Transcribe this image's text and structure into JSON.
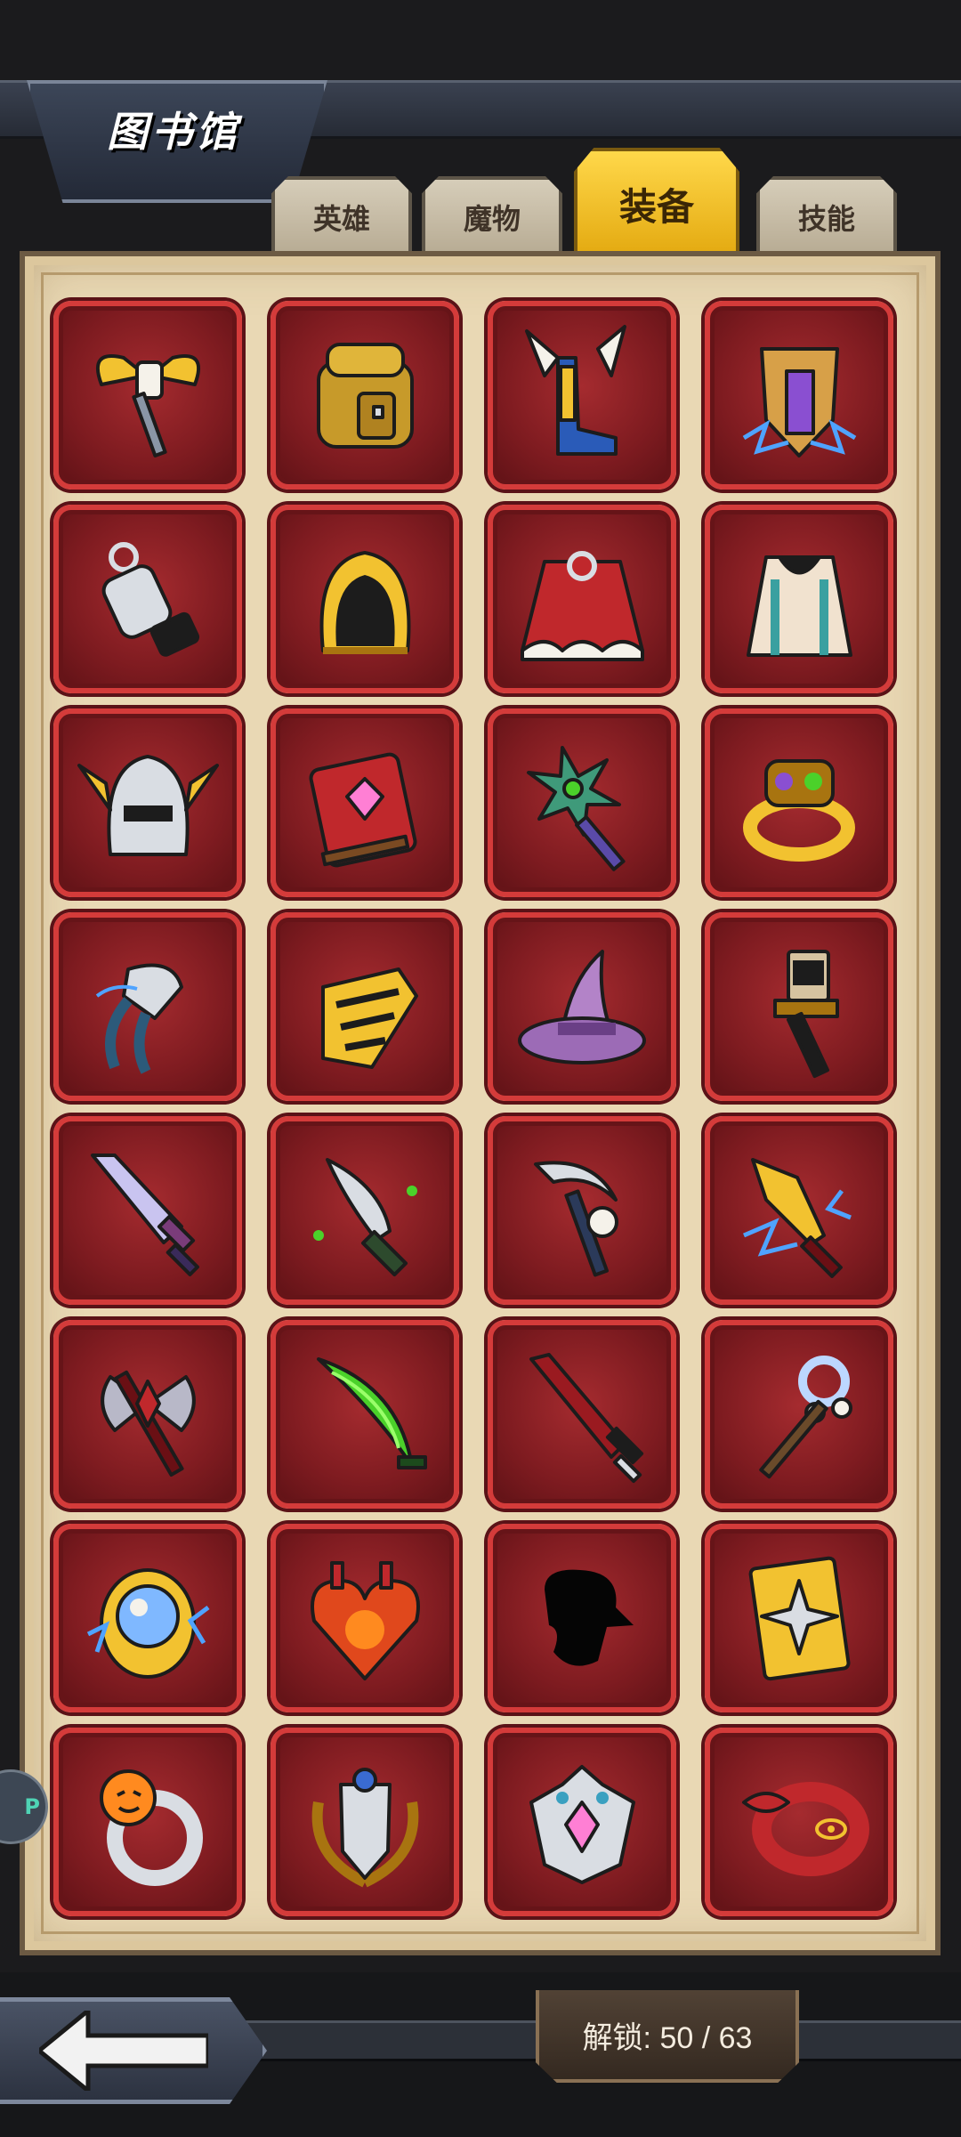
{
  "header": {
    "title": "图书馆"
  },
  "tabs": [
    {
      "label": "英雄",
      "active": false
    },
    {
      "label": "魔物",
      "active": false
    },
    {
      "label": "装备",
      "active": true
    },
    {
      "label": "技能",
      "active": false
    }
  ],
  "items": [
    {
      "icon": "winged-golden-hammer-icon",
      "locked": false
    },
    {
      "icon": "leather-backpack-icon",
      "locked": false
    },
    {
      "icon": "winged-boots-icon",
      "locked": false
    },
    {
      "icon": "lightning-shield-icon",
      "locked": false
    },
    {
      "icon": "silver-whistle-icon",
      "locked": false
    },
    {
      "icon": "golden-hood-icon",
      "locked": false
    },
    {
      "icon": "fur-cloak-icon",
      "locked": false
    },
    {
      "icon": "ornate-cape-icon",
      "locked": false
    },
    {
      "icon": "winged-helmet-icon",
      "locked": false
    },
    {
      "icon": "gem-spellbook-icon",
      "locked": false
    },
    {
      "icon": "shuriken-staff-icon",
      "locked": false
    },
    {
      "icon": "jeweled-ring-icon",
      "locked": false
    },
    {
      "icon": "frost-claw-gauntlet-icon",
      "locked": false
    },
    {
      "icon": "golden-gauntlet-icon",
      "locked": false
    },
    {
      "icon": "wizard-hat-icon",
      "locked": false
    },
    {
      "icon": "war-hammer-icon",
      "locked": false
    },
    {
      "icon": "crystal-sword-icon",
      "locked": false
    },
    {
      "icon": "poison-dagger-icon",
      "locked": false
    },
    {
      "icon": "skull-scythe-icon",
      "locked": false
    },
    {
      "icon": "lightning-dagger-icon",
      "locked": false
    },
    {
      "icon": "battle-axe-icon",
      "locked": false
    },
    {
      "icon": "green-blade-icon",
      "locked": false
    },
    {
      "icon": "crimson-greatsword-icon",
      "locked": false
    },
    {
      "icon": "bell-scepter-icon",
      "locked": false
    },
    {
      "icon": "lightning-orb-icon",
      "locked": false
    },
    {
      "icon": "burning-heart-icon",
      "locked": false
    },
    {
      "icon": "locked-silhouette-icon",
      "locked": true
    },
    {
      "icon": "spiked-shield-icon",
      "locked": false
    },
    {
      "icon": "pumpkin-ring-icon",
      "locked": false
    },
    {
      "icon": "laurel-shield-icon",
      "locked": false
    },
    {
      "icon": "gem-crown-icon",
      "locked": false
    },
    {
      "icon": "eye-bracelet-icon",
      "locked": false
    }
  ],
  "footer": {
    "unlock_text": "解锁: 50 / 63"
  },
  "side_badge": {
    "text": "P"
  },
  "colors": {
    "slot_bg": "#8a1f24",
    "slot_border": "#d43b3a",
    "tab_active": "#f4c220",
    "panel": "#e9d8b4"
  }
}
